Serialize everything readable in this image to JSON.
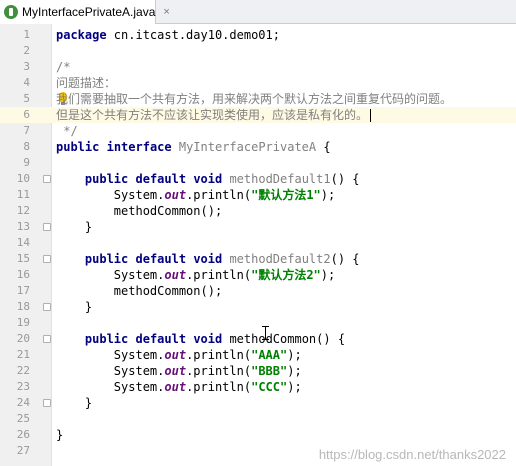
{
  "tab": {
    "filename": "MyInterfacePrivateA.java",
    "close": "×"
  },
  "watermark": "https://blog.csdn.net/thanks2022",
  "lines": [
    {
      "n": "1",
      "fold": false,
      "tokens": [
        {
          "t": "package",
          "c": "kw"
        },
        {
          "t": " cn.itcast.day10.demo01;",
          "c": ""
        }
      ]
    },
    {
      "n": "2",
      "fold": false,
      "tokens": []
    },
    {
      "n": "3",
      "fold": false,
      "tokens": [
        {
          "t": "/*",
          "c": "gray"
        }
      ]
    },
    {
      "n": "4",
      "fold": false,
      "tokens": [
        {
          "t": "问题描述：",
          "c": "cmt"
        }
      ]
    },
    {
      "n": "5",
      "fold": false,
      "bulb": true,
      "tokens": [
        {
          "t": "我们需要抽取一个共有方法，用来解决两个默认方法之间重复代码的问题。",
          "c": "cmt"
        }
      ]
    },
    {
      "n": "6",
      "fold": false,
      "current": true,
      "caret": true,
      "tokens": [
        {
          "t": "但是这个共有方法不应该让实现类使用，应该是私有化的。",
          "c": "cmt"
        }
      ]
    },
    {
      "n": "7",
      "fold": false,
      "tokens": [
        {
          "t": " */",
          "c": "gray"
        }
      ]
    },
    {
      "n": "8",
      "fold": false,
      "tokens": [
        {
          "t": "public",
          "c": "kw"
        },
        {
          "t": " ",
          "c": ""
        },
        {
          "t": "interface",
          "c": "kw"
        },
        {
          "t": " MyInterfacePrivateA",
          "c": "gray"
        },
        {
          "t": " {",
          "c": ""
        }
      ]
    },
    {
      "n": "9",
      "fold": false,
      "tokens": []
    },
    {
      "n": "10",
      "fold": true,
      "tokens": [
        {
          "t": "    ",
          "c": ""
        },
        {
          "t": "public",
          "c": "kw"
        },
        {
          "t": " ",
          "c": ""
        },
        {
          "t": "default",
          "c": "kw"
        },
        {
          "t": " ",
          "c": ""
        },
        {
          "t": "void",
          "c": "kw"
        },
        {
          "t": " methodDefault1",
          "c": "gray"
        },
        {
          "t": "() {",
          "c": ""
        }
      ]
    },
    {
      "n": "11",
      "fold": false,
      "tokens": [
        {
          "t": "        System.",
          "c": ""
        },
        {
          "t": "out",
          "c": "field"
        },
        {
          "t": ".println(",
          "c": ""
        },
        {
          "t": "\"默认方法1\"",
          "c": "str"
        },
        {
          "t": ");",
          "c": ""
        }
      ]
    },
    {
      "n": "12",
      "fold": false,
      "tokens": [
        {
          "t": "        methodCommon();",
          "c": ""
        }
      ]
    },
    {
      "n": "13",
      "fold": true,
      "tokens": [
        {
          "t": "    }",
          "c": ""
        }
      ]
    },
    {
      "n": "14",
      "fold": false,
      "tokens": []
    },
    {
      "n": "15",
      "fold": true,
      "tokens": [
        {
          "t": "    ",
          "c": ""
        },
        {
          "t": "public",
          "c": "kw"
        },
        {
          "t": " ",
          "c": ""
        },
        {
          "t": "default",
          "c": "kw"
        },
        {
          "t": " ",
          "c": ""
        },
        {
          "t": "void",
          "c": "kw"
        },
        {
          "t": " methodDefault2",
          "c": "gray"
        },
        {
          "t": "() {",
          "c": ""
        }
      ]
    },
    {
      "n": "16",
      "fold": false,
      "tokens": [
        {
          "t": "        System.",
          "c": ""
        },
        {
          "t": "out",
          "c": "field"
        },
        {
          "t": ".println(",
          "c": ""
        },
        {
          "t": "\"默认方法2\"",
          "c": "str"
        },
        {
          "t": ");",
          "c": ""
        }
      ]
    },
    {
      "n": "17",
      "fold": false,
      "tokens": [
        {
          "t": "        methodCommon();",
          "c": ""
        }
      ]
    },
    {
      "n": "18",
      "fold": true,
      "tokens": [
        {
          "t": "    }",
          "c": ""
        }
      ]
    },
    {
      "n": "19",
      "fold": false,
      "tokens": []
    },
    {
      "n": "20",
      "fold": true,
      "tokens": [
        {
          "t": "    ",
          "c": ""
        },
        {
          "t": "public",
          "c": "kw"
        },
        {
          "t": " ",
          "c": ""
        },
        {
          "t": "default",
          "c": "kw"
        },
        {
          "t": " ",
          "c": ""
        },
        {
          "t": "void",
          "c": "kw"
        },
        {
          "t": " methodCommon() {",
          "c": ""
        }
      ]
    },
    {
      "n": "21",
      "fold": false,
      "tokens": [
        {
          "t": "        System.",
          "c": ""
        },
        {
          "t": "out",
          "c": "field"
        },
        {
          "t": ".println(",
          "c": ""
        },
        {
          "t": "\"AAA\"",
          "c": "str"
        },
        {
          "t": ");",
          "c": ""
        }
      ]
    },
    {
      "n": "22",
      "fold": false,
      "tokens": [
        {
          "t": "        System.",
          "c": ""
        },
        {
          "t": "out",
          "c": "field"
        },
        {
          "t": ".println(",
          "c": ""
        },
        {
          "t": "\"BBB\"",
          "c": "str"
        },
        {
          "t": ");",
          "c": ""
        }
      ]
    },
    {
      "n": "23",
      "fold": false,
      "tokens": [
        {
          "t": "        System.",
          "c": ""
        },
        {
          "t": "out",
          "c": "field"
        },
        {
          "t": ".println(",
          "c": ""
        },
        {
          "t": "\"CCC\"",
          "c": "str"
        },
        {
          "t": ");",
          "c": ""
        }
      ]
    },
    {
      "n": "24",
      "fold": true,
      "tokens": [
        {
          "t": "    }",
          "c": ""
        }
      ]
    },
    {
      "n": "25",
      "fold": false,
      "tokens": []
    },
    {
      "n": "26",
      "fold": false,
      "tokens": [
        {
          "t": "}",
          "c": ""
        }
      ]
    },
    {
      "n": "27",
      "fold": false,
      "tokens": []
    }
  ]
}
